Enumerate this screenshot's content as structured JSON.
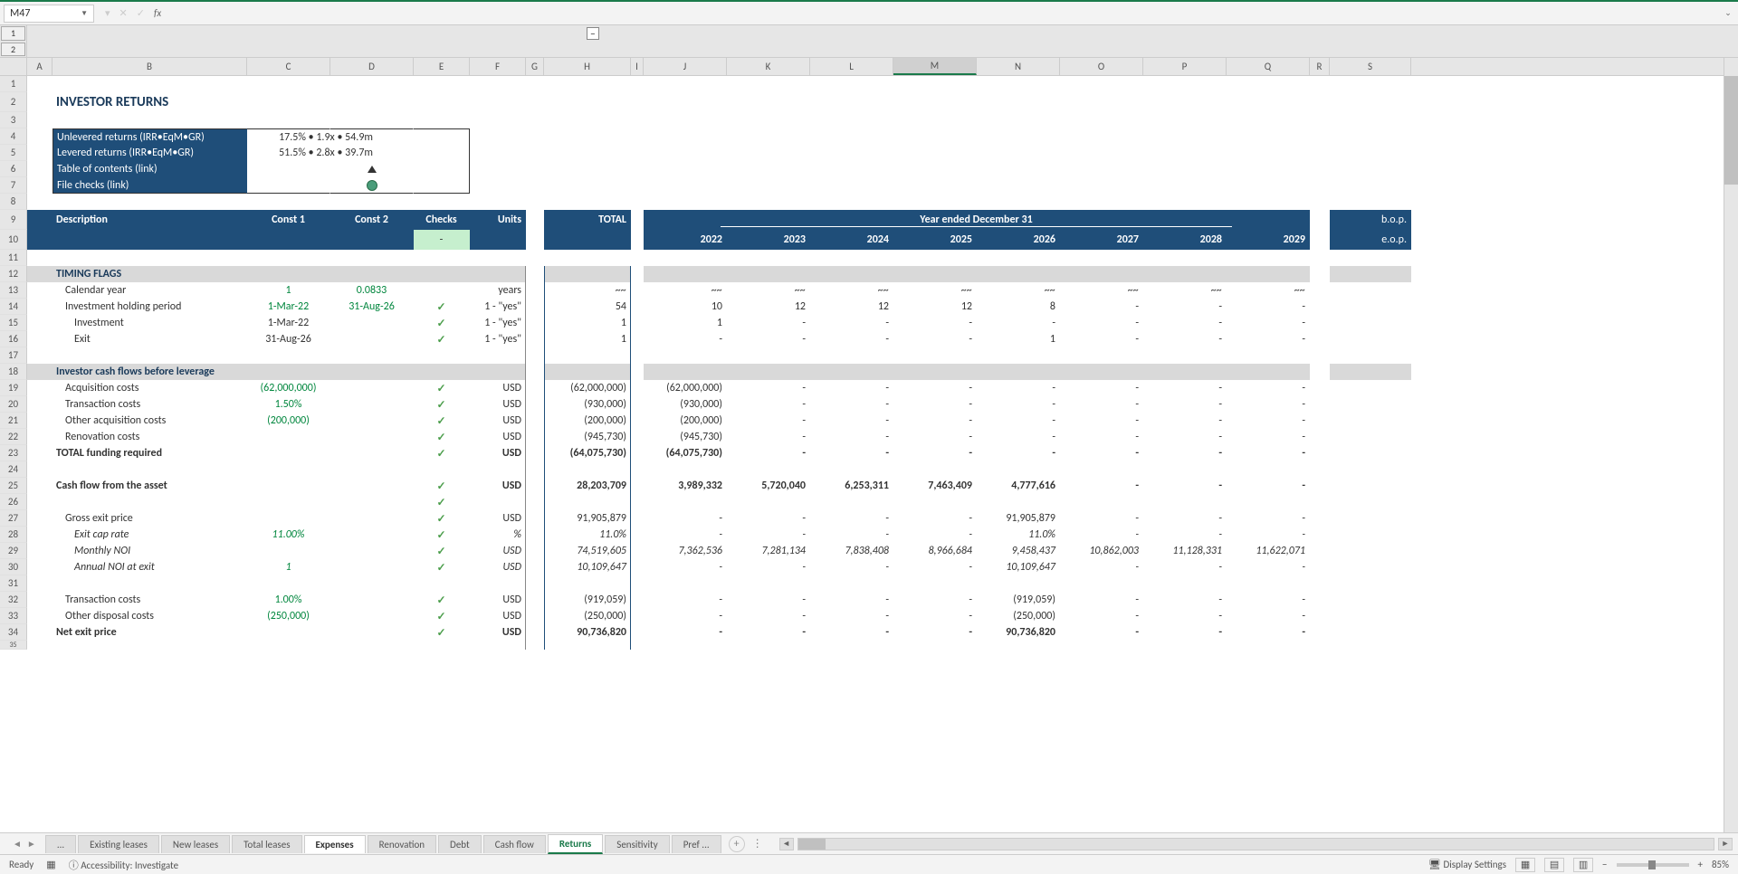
{
  "nameBox": "M47",
  "formula": "",
  "outline": {
    "levels": [
      "1",
      "2"
    ]
  },
  "columns": [
    "A",
    "B",
    "C",
    "D",
    "E",
    "F",
    "G",
    "H",
    "I",
    "J",
    "K",
    "L",
    "M",
    "N",
    "O",
    "P",
    "Q",
    "R",
    "S"
  ],
  "selectedCol": "M",
  "title": "INVESTOR RETURNS",
  "summary": {
    "unlevered_label": "Unlevered returns (IRR•EqM•GR)",
    "unlevered_value": "17.5% • 1.9x • 54.9m",
    "levered_label": "Levered returns (IRR•EqM•GR)",
    "levered_value": "51.5% • 2.8x • 39.7m",
    "toc_label": "Table of contents (link)",
    "checks_label": "File checks (link)"
  },
  "headers": {
    "desc": "Description",
    "const1": "Const 1",
    "const2": "Const 2",
    "checks": "Checks",
    "units": "Units",
    "total": "TOTAL",
    "year_header": "Year ended December 31",
    "years": [
      "2022",
      "2023",
      "2024",
      "2025",
      "2026",
      "2027",
      "2028",
      "2029"
    ],
    "bop": "b.o.p.",
    "eop": "e.o.p.",
    "dash": "-"
  },
  "sections": {
    "timing": "TIMING FLAGS",
    "cashflows": "Investor cash flows before leverage"
  },
  "rows": {
    "r13": {
      "b": "Calendar year",
      "c": "1",
      "d": "0.0833",
      "f": "years",
      "h": "~~",
      "j": "~~",
      "k": "~~",
      "l": "~~",
      "m": "~~",
      "n": "~~",
      "o": "~~",
      "p": "~~",
      "q": "~~"
    },
    "r14": {
      "b": "Investment holding period",
      "c": "1-Mar-22",
      "d": "31-Aug-26",
      "f": "1 - \"yes\"",
      "h": "54",
      "j": "10",
      "k": "12",
      "l": "12",
      "m": "12",
      "n": "8",
      "o": "-",
      "p": "-",
      "q": "-"
    },
    "r15": {
      "b": "Investment",
      "c": "1-Mar-22",
      "f": "1 - \"yes\"",
      "h": "1",
      "j": "1",
      "k": "-",
      "l": "-",
      "m": "-",
      "n": "-",
      "o": "-",
      "p": "-",
      "q": "-"
    },
    "r16": {
      "b": "Exit",
      "c": "31-Aug-26",
      "f": "1 - \"yes\"",
      "h": "1",
      "j": "-",
      "k": "-",
      "l": "-",
      "m": "-",
      "n": "1",
      "o": "-",
      "p": "-",
      "q": "-"
    },
    "r19": {
      "b": "Acquisition costs",
      "c": "(62,000,000)",
      "f": "USD",
      "h": "(62,000,000)",
      "j": "(62,000,000)",
      "k": "-",
      "l": "-",
      "m": "-",
      "n": "-",
      "o": "-",
      "p": "-",
      "q": "-"
    },
    "r20": {
      "b": "Transaction costs",
      "c": "1.50%",
      "f": "USD",
      "h": "(930,000)",
      "j": "(930,000)",
      "k": "-",
      "l": "-",
      "m": "-",
      "n": "-",
      "o": "-",
      "p": "-",
      "q": "-"
    },
    "r21": {
      "b": "Other acquisition costs",
      "c": "(200,000)",
      "f": "USD",
      "h": "(200,000)",
      "j": "(200,000)",
      "k": "-",
      "l": "-",
      "m": "-",
      "n": "-",
      "o": "-",
      "p": "-",
      "q": "-"
    },
    "r22": {
      "b": "Renovation costs",
      "f": "USD",
      "h": "(945,730)",
      "j": "(945,730)",
      "k": "-",
      "l": "-",
      "m": "-",
      "n": "-",
      "o": "-",
      "p": "-",
      "q": "-"
    },
    "r23": {
      "b": "TOTAL funding required",
      "f": "USD",
      "h": "(64,075,730)",
      "j": "(64,075,730)",
      "k": "-",
      "l": "-",
      "m": "-",
      "n": "-",
      "o": "-",
      "p": "-",
      "q": "-"
    },
    "r25": {
      "b": "Cash flow from the asset",
      "f": "USD",
      "h": "28,203,709",
      "j": "3,989,332",
      "k": "5,720,040",
      "l": "6,253,311",
      "m": "7,463,409",
      "n": "4,777,616",
      "o": "-",
      "p": "-",
      "q": "-"
    },
    "r27": {
      "b": "Gross exit price",
      "f": "USD",
      "h": "91,905,879",
      "j": "-",
      "k": "-",
      "l": "-",
      "m": "-",
      "n": "91,905,879",
      "o": "-",
      "p": "-",
      "q": "-"
    },
    "r28": {
      "b": "Exit cap rate",
      "c": "11.00%",
      "f": "%",
      "h": "11.0%",
      "j": "-",
      "k": "-",
      "l": "-",
      "m": "-",
      "n": "11.0%",
      "o": "-",
      "p": "-",
      "q": "-"
    },
    "r29": {
      "b": "Monthly NOI",
      "f": "USD",
      "h": "74,519,605",
      "j": "7,362,536",
      "k": "7,281,134",
      "l": "7,838,408",
      "m": "8,966,684",
      "n": "9,458,437",
      "o": "10,862,003",
      "p": "11,128,331",
      "q": "11,622,071"
    },
    "r30": {
      "b": "Annual NOI at exit",
      "c": "1",
      "f": "USD",
      "h": "10,109,647",
      "j": "-",
      "k": "-",
      "l": "-",
      "m": "-",
      "n": "10,109,647",
      "o": "-",
      "p": "-",
      "q": "-"
    },
    "r32": {
      "b": "Transaction costs",
      "c": "1.00%",
      "f": "USD",
      "h": "(919,059)",
      "j": "-",
      "k": "-",
      "l": "-",
      "m": "-",
      "n": "(919,059)",
      "o": "-",
      "p": "-",
      "q": "-"
    },
    "r33": {
      "b": "Other disposal costs",
      "c": "(250,000)",
      "f": "USD",
      "h": "(250,000)",
      "j": "-",
      "k": "-",
      "l": "-",
      "m": "-",
      "n": "(250,000)",
      "o": "-",
      "p": "-",
      "q": "-"
    },
    "r34": {
      "b": "Net exit price",
      "f": "USD",
      "h": "90,736,820",
      "j": "-",
      "k": "-",
      "l": "-",
      "m": "-",
      "n": "90,736,820",
      "o": "-",
      "p": "-",
      "q": "-"
    }
  },
  "tabs": {
    "more": "...",
    "list": [
      "Existing leases",
      "New leases",
      "Total leases",
      "Expenses",
      "Renovation",
      "Debt",
      "Cash flow",
      "Returns",
      "Sensitivity",
      "Pref ..."
    ],
    "active": "Returns",
    "semi": "Expenses"
  },
  "status": {
    "ready": "Ready",
    "accessibility": "Accessibility: Investigate",
    "display": "Display Settings",
    "zoom": "85%"
  }
}
